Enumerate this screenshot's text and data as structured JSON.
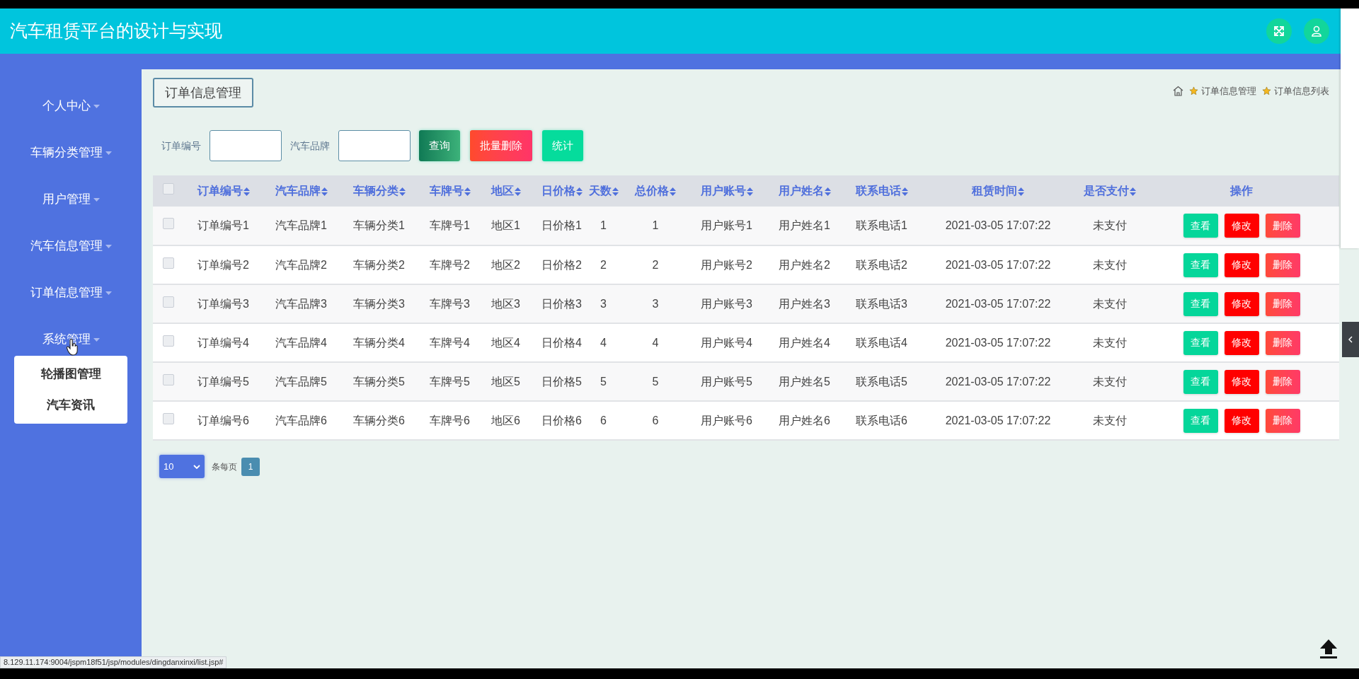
{
  "header": {
    "title": "汽车租赁平台的设计与实现"
  },
  "sidebar": {
    "items": [
      {
        "label": "个人中心"
      },
      {
        "label": "车辆分类管理"
      },
      {
        "label": "用户管理"
      },
      {
        "label": "汽车信息管理"
      },
      {
        "label": "订单信息管理"
      },
      {
        "label": "系统管理",
        "children": [
          {
            "label": "轮播图管理"
          },
          {
            "label": "汽车资讯"
          }
        ]
      }
    ]
  },
  "page_title": "订单信息管理",
  "breadcrumb": [
    "订单信息管理",
    "订单信息列表"
  ],
  "search": {
    "fields": [
      {
        "label": "订单编号"
      },
      {
        "label": "汽车品牌"
      }
    ],
    "buttons": [
      {
        "label": "查询",
        "kind": "search"
      },
      {
        "label": "批量删除",
        "kind": "delete"
      },
      {
        "label": "统计",
        "kind": "stats"
      }
    ]
  },
  "table": {
    "select_all_checked": false,
    "columns": [
      {
        "label": "订单编号",
        "sortable": true
      },
      {
        "label": "汽车品牌",
        "sortable": true
      },
      {
        "label": "车辆分类",
        "sortable": true
      },
      {
        "label": "车牌号",
        "sortable": true
      },
      {
        "label": "地区",
        "sortable": true
      },
      {
        "label": "日价格",
        "sortable": true
      },
      {
        "label": "天数",
        "sortable": true
      },
      {
        "label": "总价格",
        "sortable": true
      },
      {
        "label": "用户账号",
        "sortable": true
      },
      {
        "label": "用户姓名",
        "sortable": true
      },
      {
        "label": "联系电话",
        "sortable": true
      },
      {
        "label": "租赁时间",
        "sortable": true
      },
      {
        "label": "是否支付",
        "sortable": true
      },
      {
        "label": "操作",
        "sortable": false
      }
    ],
    "rows": [
      {
        "checked": false,
        "cells": [
          "订单编号1",
          "汽车品牌1",
          "车辆分类1",
          "车牌号1",
          "地区1",
          "日价格1",
          "1",
          "1",
          "用户账号1",
          "用户姓名1",
          "联系电话1",
          "2021-03-05 17:07:22",
          "未支付"
        ],
        "actions": [
          {
            "label": "查看",
            "kind": "view"
          },
          {
            "label": "修改",
            "kind": "edit"
          },
          {
            "label": "删除",
            "kind": "delete"
          }
        ]
      },
      {
        "checked": false,
        "cells": [
          "订单编号2",
          "汽车品牌2",
          "车辆分类2",
          "车牌号2",
          "地区2",
          "日价格2",
          "2",
          "2",
          "用户账号2",
          "用户姓名2",
          "联系电话2",
          "2021-03-05 17:07:22",
          "未支付"
        ],
        "actions": [
          {
            "label": "查看",
            "kind": "view"
          },
          {
            "label": "修改",
            "kind": "edit"
          },
          {
            "label": "删除",
            "kind": "delete"
          }
        ]
      },
      {
        "checked": false,
        "cells": [
          "订单编号3",
          "汽车品牌3",
          "车辆分类3",
          "车牌号3",
          "地区3",
          "日价格3",
          "3",
          "3",
          "用户账号3",
          "用户姓名3",
          "联系电话3",
          "2021-03-05 17:07:22",
          "未支付"
        ],
        "actions": [
          {
            "label": "查看",
            "kind": "view"
          },
          {
            "label": "修改",
            "kind": "edit"
          },
          {
            "label": "删除",
            "kind": "delete"
          }
        ]
      },
      {
        "checked": false,
        "cells": [
          "订单编号4",
          "汽车品牌4",
          "车辆分类4",
          "车牌号4",
          "地区4",
          "日价格4",
          "4",
          "4",
          "用户账号4",
          "用户姓名4",
          "联系电话4",
          "2021-03-05 17:07:22",
          "未支付"
        ],
        "actions": [
          {
            "label": "查看",
            "kind": "view"
          },
          {
            "label": "修改",
            "kind": "edit"
          },
          {
            "label": "删除",
            "kind": "delete"
          }
        ]
      },
      {
        "checked": false,
        "cells": [
          "订单编号5",
          "汽车品牌5",
          "车辆分类5",
          "车牌号5",
          "地区5",
          "日价格5",
          "5",
          "5",
          "用户账号5",
          "用户姓名5",
          "联系电话5",
          "2021-03-05 17:07:22",
          "未支付"
        ],
        "actions": [
          {
            "label": "查看",
            "kind": "view"
          },
          {
            "label": "修改",
            "kind": "edit"
          },
          {
            "label": "删除",
            "kind": "delete"
          }
        ]
      },
      {
        "checked": false,
        "cells": [
          "订单编号6",
          "汽车品牌6",
          "车辆分类6",
          "车牌号6",
          "地区6",
          "日价格6",
          "6",
          "6",
          "用户账号6",
          "用户姓名6",
          "联系电话6",
          "2021-03-05 17:07:22",
          "未支付"
        ],
        "actions": [
          {
            "label": "查看",
            "kind": "view"
          },
          {
            "label": "修改",
            "kind": "edit"
          },
          {
            "label": "删除",
            "kind": "delete"
          }
        ]
      }
    ]
  },
  "pagination": {
    "page_size": "10",
    "per_page_label": "条每页",
    "pages": [
      {
        "label": "1",
        "selected": true
      }
    ]
  },
  "status_url": "8.129.11.174:9004/jspm18f51/jsp/modules/dingdanxinxi/list.jsp#"
}
